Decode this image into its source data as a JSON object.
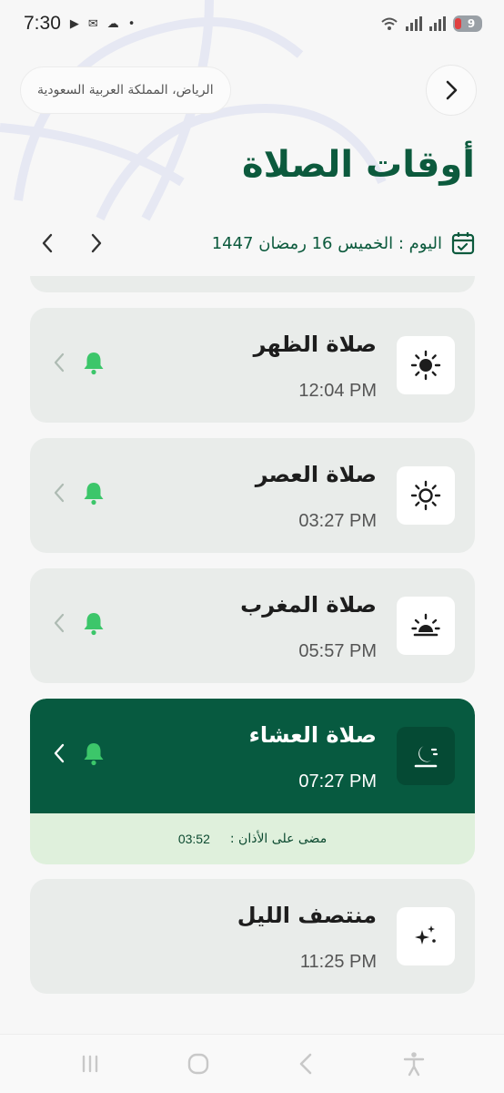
{
  "status_bar": {
    "time": "7:30",
    "battery_level": "9",
    "icons": [
      "play-icon",
      "mail-icon",
      "weather-icon",
      "dot-icon",
      "wifi-icon",
      "signal-icon",
      "signal-icon",
      "battery-icon"
    ]
  },
  "header": {
    "location": "الرياض، المملكة العربية السعودية",
    "back_icon": "chevron-right-icon"
  },
  "page_title": "أوقات الصلاة",
  "date_row": {
    "today": "اليوم : الخميس 16 رمضان 1447",
    "calendar_icon": "calendar-check-icon",
    "prev_icon": "chevron-left-icon",
    "next_icon": "chevron-right-icon"
  },
  "prayers": [
    {
      "name": "صلاة الظهر",
      "time": "12:04 PM",
      "icon": "sun-icon",
      "active": false
    },
    {
      "name": "صلاة العصر",
      "time": "03:27 PM",
      "icon": "sun-outline-icon",
      "active": false
    },
    {
      "name": "صلاة المغرب",
      "time": "05:57 PM",
      "icon": "sunset-icon",
      "active": false
    },
    {
      "name": "صلاة العشاء",
      "time": "07:27 PM",
      "icon": "moon-icon",
      "active": true
    },
    {
      "name": "منتصف الليل",
      "time": "11:25 PM",
      "icon": "sparkles-icon",
      "active": false
    }
  ],
  "elapsed": {
    "label": "مضى على الأذان :",
    "value": "03:52"
  },
  "colors": {
    "brand_green": "#0c5a3d",
    "active_card": "#075a40",
    "bell_green": "#3cc66a",
    "card_bg": "#e9ecea",
    "elapsed_bg": "#dff0dc"
  },
  "nav_bar": {
    "buttons": [
      "recents-icon",
      "home-icon",
      "back-icon",
      "accessibility-icon"
    ]
  }
}
